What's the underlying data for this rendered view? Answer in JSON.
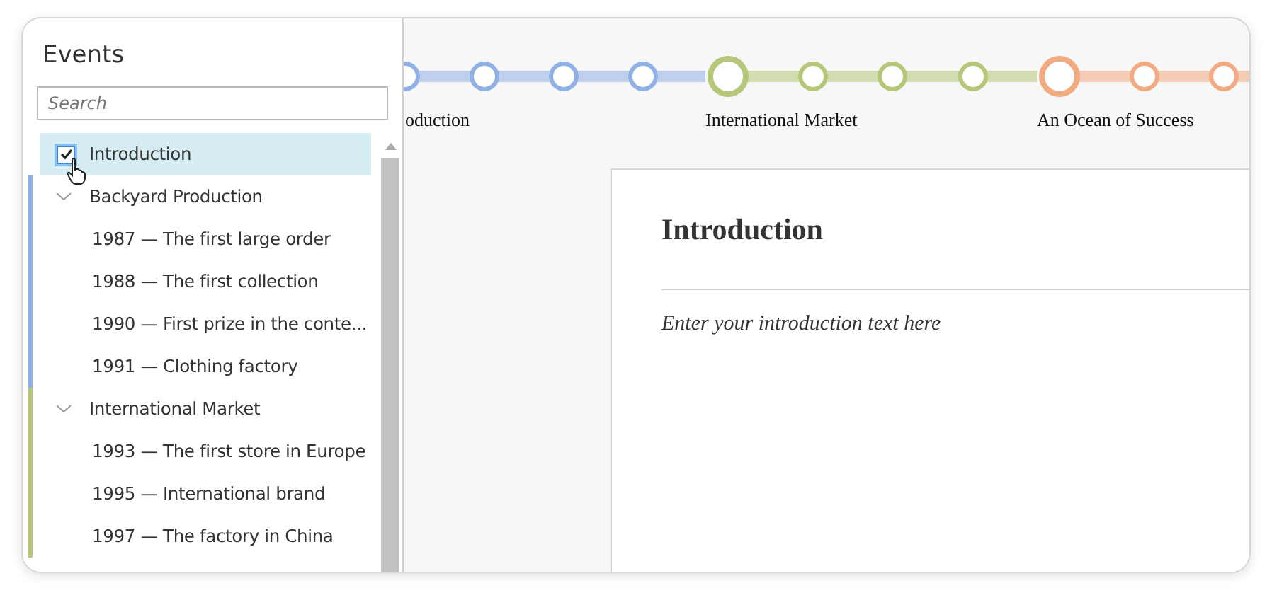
{
  "sidebar": {
    "title": "Events",
    "search": {
      "placeholder": "Search"
    },
    "items": [
      {
        "kind": "item",
        "label": "Introduction",
        "checked": true,
        "selected": true
      },
      {
        "kind": "group",
        "label": "Backyard Production",
        "expanded": true,
        "color": "#8fb1e3",
        "children": [
          {
            "label": "1987 — The first large order"
          },
          {
            "label": "1988 — The first collection"
          },
          {
            "label": "1990 — First prize in the conte..."
          },
          {
            "label": "1991 — Clothing factory"
          }
        ]
      },
      {
        "kind": "group",
        "label": "International Market",
        "expanded": true,
        "color": "#b8c77a",
        "children": [
          {
            "label": "1993 — The first store in Europe"
          },
          {
            "label": "1995 — International brand"
          },
          {
            "label": "1997 — The factory in China"
          }
        ]
      }
    ]
  },
  "timeline": {
    "groups": [
      {
        "kind": "partial",
        "label": "oduction",
        "color": "#8fb1e3"
      },
      {
        "kind": "full",
        "label": "International Market",
        "color": "#b5c778"
      },
      {
        "kind": "full",
        "label": "An Ocean of Success",
        "color": "#f2aa80"
      }
    ]
  },
  "document": {
    "title": "Introduction",
    "body": "Enter your introduction text here"
  }
}
